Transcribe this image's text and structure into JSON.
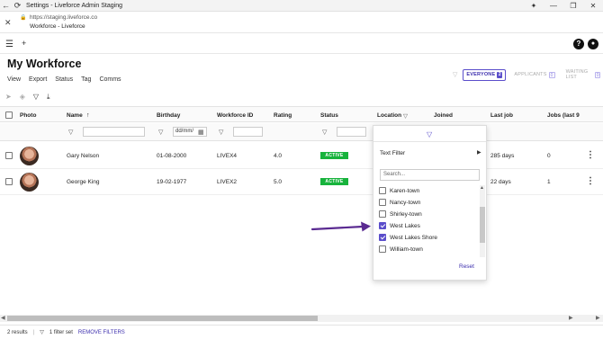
{
  "window": {
    "title": "Settings - Liveforce Admin Staging"
  },
  "browser": {
    "url": "https://staging.liveforce.co",
    "page_title": "Workforce - Liveforce"
  },
  "page": {
    "title": "My Workforce"
  },
  "menu": [
    "View",
    "Export",
    "Status",
    "Tag",
    "Comms"
  ],
  "tabs": [
    {
      "label": "EVERYONE",
      "count": "2",
      "active": true
    },
    {
      "label": "APPLICANTS",
      "count": "0",
      "active": false
    },
    {
      "label": "WAITING LIST",
      "count": "0",
      "active": false
    }
  ],
  "columns": [
    "Photo",
    "Name",
    "Birthday",
    "Workforce ID",
    "Rating",
    "Status",
    "Location",
    "Joined",
    "Last job",
    "Jobs (last 9"
  ],
  "filters": {
    "birthday_placeholder": "dd/mm/"
  },
  "rows": [
    {
      "name": "Gary Nelson",
      "birthday": "01-08-2000",
      "workforce_id": "LIVEX4",
      "rating": "4.0",
      "status": "ACTIVE",
      "last_job": "285 days",
      "jobs": "0"
    },
    {
      "name": "George King",
      "birthday": "19-02-1977",
      "workforce_id": "LIVEX2",
      "rating": "5.0",
      "status": "ACTIVE",
      "last_job": "22 days",
      "jobs": "1"
    }
  ],
  "location_filter": {
    "text_filter_label": "Text Filter",
    "search_placeholder": "Search...",
    "options": [
      {
        "label": "Karen-town",
        "checked": false
      },
      {
        "label": "Nancy-town",
        "checked": false
      },
      {
        "label": "Shirley-town",
        "checked": false
      },
      {
        "label": "West Lakes",
        "checked": true
      },
      {
        "label": "West Lakes Shore",
        "checked": true
      },
      {
        "label": "William-town",
        "checked": false
      }
    ],
    "reset_label": "Reset"
  },
  "footer": {
    "results": "2 results",
    "filters_set": "1 filter set",
    "remove_filters": "REMOVE FILTERS"
  },
  "colors": {
    "accent": "#5b4ecb",
    "status_active": "#17b33c",
    "arrow": "#5a2a91"
  }
}
